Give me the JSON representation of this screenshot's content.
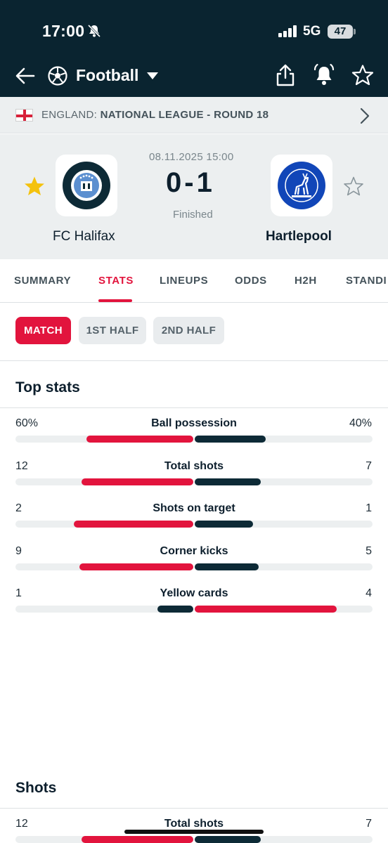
{
  "status_bar": {
    "time": "17:00",
    "network": "5G",
    "battery": "47"
  },
  "header": {
    "sport": "Football"
  },
  "league": {
    "country": "ENGLAND:",
    "competition": "NATIONAL LEAGUE - ROUND 18"
  },
  "match": {
    "datetime": "08.11.2025 15:00",
    "score": "0-1",
    "status": "Finished",
    "home": {
      "name": "FC Halifax",
      "favorite": true
    },
    "away": {
      "name": "Hartlepool",
      "favorite": false
    }
  },
  "tabs": [
    "SUMMARY",
    "STATS",
    "LINEUPS",
    "ODDS",
    "H2H",
    "STANDI"
  ],
  "active_tab": "STATS",
  "periods": [
    "MATCH",
    "1ST HALF",
    "2ND HALF"
  ],
  "active_period": "MATCH",
  "sections": {
    "top_stats": {
      "title": "Top stats",
      "rows": [
        {
          "label": "Ball possession",
          "home": "60%",
          "away": "40%",
          "home_ratio": 0.6,
          "away_ratio": 0.4
        },
        {
          "label": "Total shots",
          "home": "12",
          "away": "7",
          "home_ratio": 0.63,
          "away_ratio": 0.37
        },
        {
          "label": "Shots on target",
          "home": "2",
          "away": "1",
          "home_ratio": 0.67,
          "away_ratio": 0.33
        },
        {
          "label": "Corner kicks",
          "home": "9",
          "away": "5",
          "home_ratio": 0.64,
          "away_ratio": 0.36
        },
        {
          "label": "Yellow cards",
          "home": "1",
          "away": "4",
          "home_ratio": 0.2,
          "away_ratio": 0.8
        }
      ]
    },
    "shots": {
      "title": "Shots",
      "rows": [
        {
          "label": "Total shots",
          "home": "12",
          "away": "7",
          "home_ratio": 0.63,
          "away_ratio": 0.37
        }
      ]
    }
  },
  "colors": {
    "header_bg": "#0a2430",
    "accent": "#e2143d",
    "secondary_bar": "#0d2a36",
    "gold_star": "#f4c20d"
  }
}
